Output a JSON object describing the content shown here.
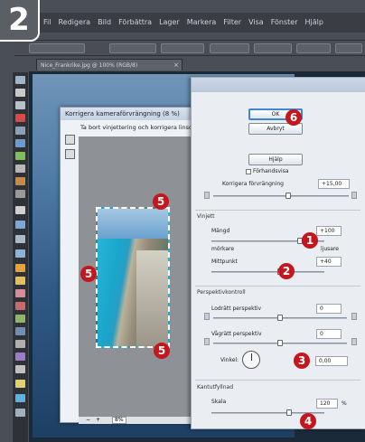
{
  "step_badge": "2",
  "menubar": [
    "Fil",
    "Redigera",
    "Bild",
    "Förbättra",
    "Lager",
    "Markera",
    "Filter",
    "Visa",
    "Fönster",
    "Hjälp"
  ],
  "document_tab": "Nice_Frankrike.jpg @ 100% (RGB/8)",
  "lens_dialog": {
    "title": "Korrigera kameraförvrängning (8 %)",
    "hint": "Ta bort vinjettering och korrigera linsdistorsion",
    "zoom_value": "8%"
  },
  "panel": {
    "ok": "OK",
    "cancel": "Avbryt",
    "help": "Hjälp",
    "preview_label": "Förhandsvisa",
    "distortion_label": "Korrigera förvrängning",
    "distortion_value": "+15,00",
    "vignette_group": "Vinjett",
    "amount_label": "Mängd",
    "amount_value": "+100",
    "darken": "mörkare",
    "lighten": "ljusare",
    "midpoint_label": "Mittpunkt",
    "midpoint_value": "+40",
    "perspective_group": "Perspektivkontroll",
    "vertical_label": "Lodrätt perspektiv",
    "vertical_value": "0",
    "horizontal_label": "Vågrätt perspektiv",
    "horizontal_value": "0",
    "angle_label": "Vinkel:",
    "angle_value": "0,00",
    "edge_group": "Kantutfyllnad",
    "scale_label": "Skala",
    "scale_value": "120",
    "percent": "%"
  },
  "callouts": [
    "6",
    "1",
    "2",
    "3",
    "4",
    "5",
    "5",
    "5"
  ]
}
